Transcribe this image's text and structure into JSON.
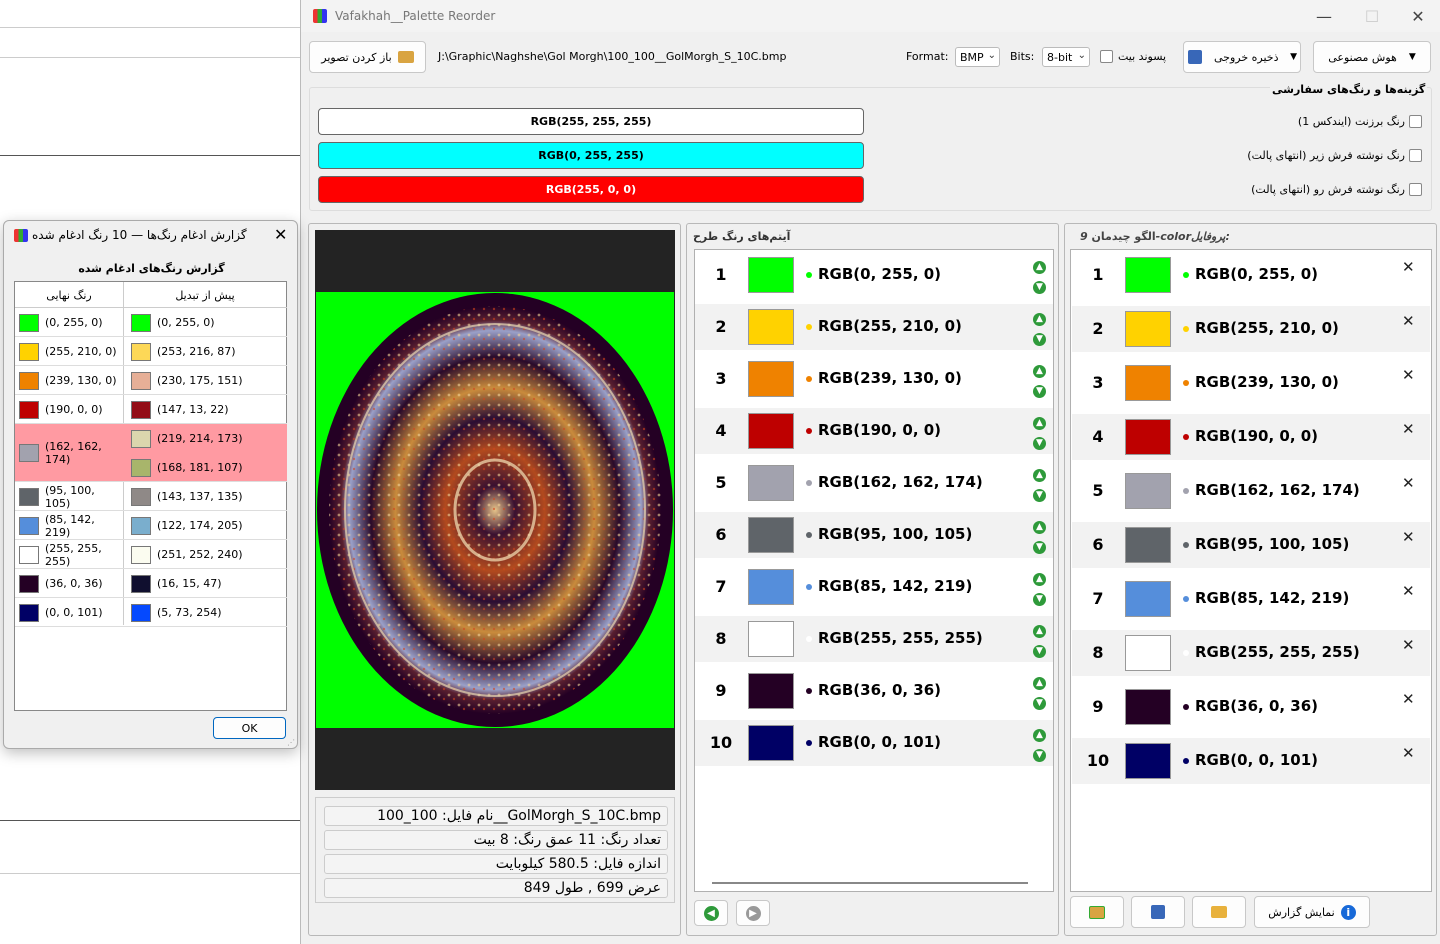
{
  "main_window": {
    "title": "Vafakhah__Palette Reorder",
    "open_image_label": "باز کردن تصویر",
    "file_path": "J:\\Graphic\\Naghshe\\Gol Morgh\\100_100__GolMorgh_S_10C.bmp",
    "format_label": "Format:",
    "format_value": "BMP",
    "bits_label": "Bits:",
    "bits_value": "8-bit",
    "suffix_label": "پسوند بیت",
    "save_output_label": "ذخیره خروجی",
    "ai_label": "هوش مصنوعی"
  },
  "options": {
    "title": "گزینه‌ها و رنگ‌های سفارشی",
    "items": [
      {
        "label": "رنگ برزنت (ایندکس 1)",
        "bar_text": "RGB(255, 255, 255)",
        "bar_color": "#ffffff"
      },
      {
        "label": "رنگ نوشته فرش زیر (انتهای پالت)",
        "bar_text": "RGB(0, 255, 255)",
        "bar_color": "#00ffff"
      },
      {
        "label": "رنگ نوشته فرش رو (انتهای پالت)",
        "bar_text": "RGB(255, 0, 0)",
        "bar_color": "#ff0000"
      }
    ]
  },
  "file_info": {
    "name": "نام فایل:  100_100__GolMorgh_S_10C.bmp",
    "colors": "تعداد رنگ:  11          عمق رنگ: 8 بیت",
    "size": "اندازه فایل: 580.5 کیلوبایت",
    "dims": "عرض 699 , طول 849"
  },
  "design_panel": {
    "title": "آیتم‌های رنگ طرح",
    "items": [
      {
        "num": "1",
        "rgb": "RGB(0, 255, 0)",
        "color": "#00ff00"
      },
      {
        "num": "2",
        "rgb": "RGB(255, 210, 0)",
        "color": "#ffd200"
      },
      {
        "num": "3",
        "rgb": "RGB(239, 130, 0)",
        "color": "#ef8200"
      },
      {
        "num": "4",
        "rgb": "RGB(190, 0, 0)",
        "color": "#be0000"
      },
      {
        "num": "5",
        "rgb": "RGB(162, 162, 174)",
        "color": "#a2a2ae"
      },
      {
        "num": "6",
        "rgb": "RGB(95, 100, 105)",
        "color": "#5f6469"
      },
      {
        "num": "7",
        "rgb": "RGB(85, 142, 219)",
        "color": "#558edb"
      },
      {
        "num": "8",
        "rgb": "RGB(255, 255, 255)",
        "color": "#ffffff"
      },
      {
        "num": "9",
        "rgb": "RGB(36, 0, 36)",
        "color": "#240024"
      },
      {
        "num": "10",
        "rgb": "RGB(0, 0, 101)",
        "color": "#000065"
      }
    ]
  },
  "profile_panel": {
    "title_prefix": "پروفایل:",
    "title_profile": "9-color",
    "title_suffix": "الگو چیدمان",
    "report_button": "نمایش گزارش"
  },
  "dialog": {
    "title": "گزارش ادغام رنگ‌ها — 10 رنگ ادغام شده",
    "heading": "گزارش رنگ‌های ادغام شده",
    "col_final": "رنگ نهایی",
    "col_before": "پیش از تبدیل",
    "ok_label": "OK",
    "rows": [
      {
        "final": "(0, 255, 0)",
        "final_color": "#00ff00",
        "before": [
          {
            "text": "(0, 255, 0)",
            "color": "#00ff00"
          }
        ]
      },
      {
        "final": "(255, 210, 0)",
        "final_color": "#ffd200",
        "before": [
          {
            "text": "(253, 216, 87)",
            "color": "#fdd857"
          }
        ]
      },
      {
        "final": "(239, 130, 0)",
        "final_color": "#ef8200",
        "before": [
          {
            "text": "(230, 175, 151)",
            "color": "#e6af97"
          }
        ]
      },
      {
        "final": "(190, 0, 0)",
        "final_color": "#be0000",
        "before": [
          {
            "text": "(147, 13, 22)",
            "color": "#930d16"
          }
        ]
      },
      {
        "final": "(162, 162, 174)",
        "final_color": "#a2a2ae",
        "before": [
          {
            "text": "(219, 214, 173)",
            "color": "#dbd6ad"
          },
          {
            "text": "(168, 181, 107)",
            "color": "#a8b56b"
          }
        ]
      },
      {
        "final": "(95, 100, 105)",
        "final_color": "#5f6469",
        "before": [
          {
            "text": "(143, 137, 135)",
            "color": "#8f8987"
          }
        ]
      },
      {
        "final": "(85, 142, 219)",
        "final_color": "#558edb",
        "before": [
          {
            "text": "(122, 174, 205)",
            "color": "#7aaecd"
          }
        ]
      },
      {
        "final": "(255, 255, 255)",
        "final_color": "#ffffff",
        "before": [
          {
            "text": "(251, 252, 240)",
            "color": "#fbfcf0"
          }
        ]
      },
      {
        "final": "(36, 0, 36)",
        "final_color": "#240024",
        "before": [
          {
            "text": "(16, 15, 47)",
            "color": "#100f2f"
          }
        ]
      },
      {
        "final": "(0, 0, 101)",
        "final_color": "#000065",
        "before": [
          {
            "text": "(5, 73, 254)",
            "color": "#0549fe"
          }
        ]
      }
    ]
  }
}
